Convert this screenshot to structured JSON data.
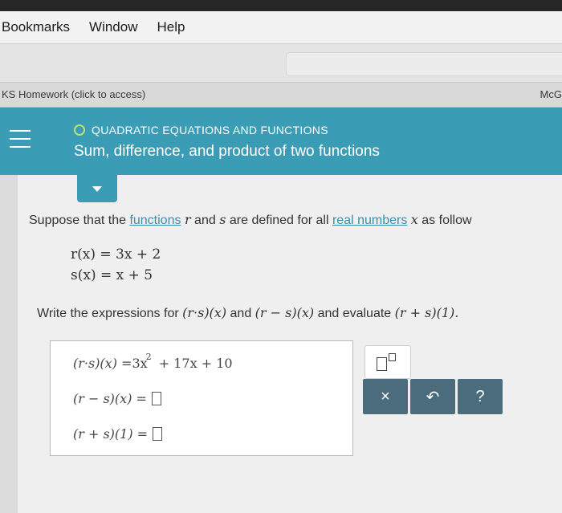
{
  "menu": {
    "items": [
      "Bookmarks",
      "Window",
      "Help"
    ]
  },
  "tabstrip": {
    "left": "KS Homework (click to access)",
    "right": "McG"
  },
  "header": {
    "section": "QUADRATIC EQUATIONS AND FUNCTIONS",
    "title": "Sum, difference, and product of two functions"
  },
  "question": {
    "intro_prefix": "Suppose that the",
    "link_functions": "functions",
    "intro_mid1": "r",
    "intro_mid2": "and",
    "intro_mid3": "s",
    "intro_mid4": "are defined for all",
    "link_real": "real numbers",
    "intro_mid5": "x",
    "intro_suffix": "as follow",
    "def_r": "r(x) = 3x + 2",
    "def_s": "s(x) = x + 5",
    "prompt_prefix": "Write the expressions for",
    "expr1": "(r·s)(x)",
    "prompt_and": "and",
    "expr2": "(r − s)(x)",
    "prompt_and2": "and evaluate",
    "expr3": "(r + s)(1)."
  },
  "answers": {
    "row1_label": "(r·s)(x) = ",
    "row1_value_pre": "3x",
    "row1_exp": "2",
    "row1_value_post": "+ 17x + 10",
    "row2_label": "(r − s)(x) = ",
    "row3_label": "(r + s)(1) = "
  },
  "keys": {
    "clear": "×",
    "undo": "↶",
    "help": "?"
  },
  "colors": {
    "header_bg": "#3a9db5",
    "key_bg": "#4a6c7c",
    "link": "#3a8fb0"
  }
}
